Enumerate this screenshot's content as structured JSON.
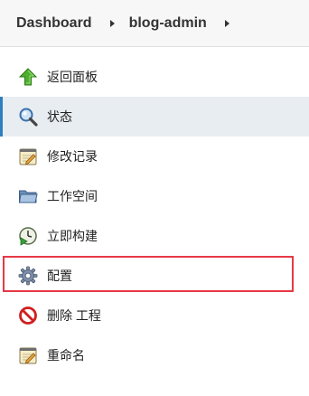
{
  "breadcrumb": {
    "items": [
      {
        "label": "Dashboard"
      },
      {
        "label": "blog-admin"
      }
    ]
  },
  "sidebar": {
    "items": [
      {
        "label": "返回面板",
        "icon": "up-arrow-icon"
      },
      {
        "label": "状态",
        "icon": "magnifier-icon",
        "active": true
      },
      {
        "label": "修改记录",
        "icon": "notepad-icon"
      },
      {
        "label": "工作空间",
        "icon": "folder-icon"
      },
      {
        "label": "立即构建",
        "icon": "clock-play-icon"
      },
      {
        "label": "配置",
        "icon": "gear-icon",
        "highlighted": true
      },
      {
        "label": "删除 工程",
        "icon": "no-entry-icon"
      },
      {
        "label": "重命名",
        "icon": "notepad-icon"
      }
    ]
  },
  "colors": {
    "active_indicator": "#2e7ec0",
    "highlight_border": "#e63946"
  }
}
